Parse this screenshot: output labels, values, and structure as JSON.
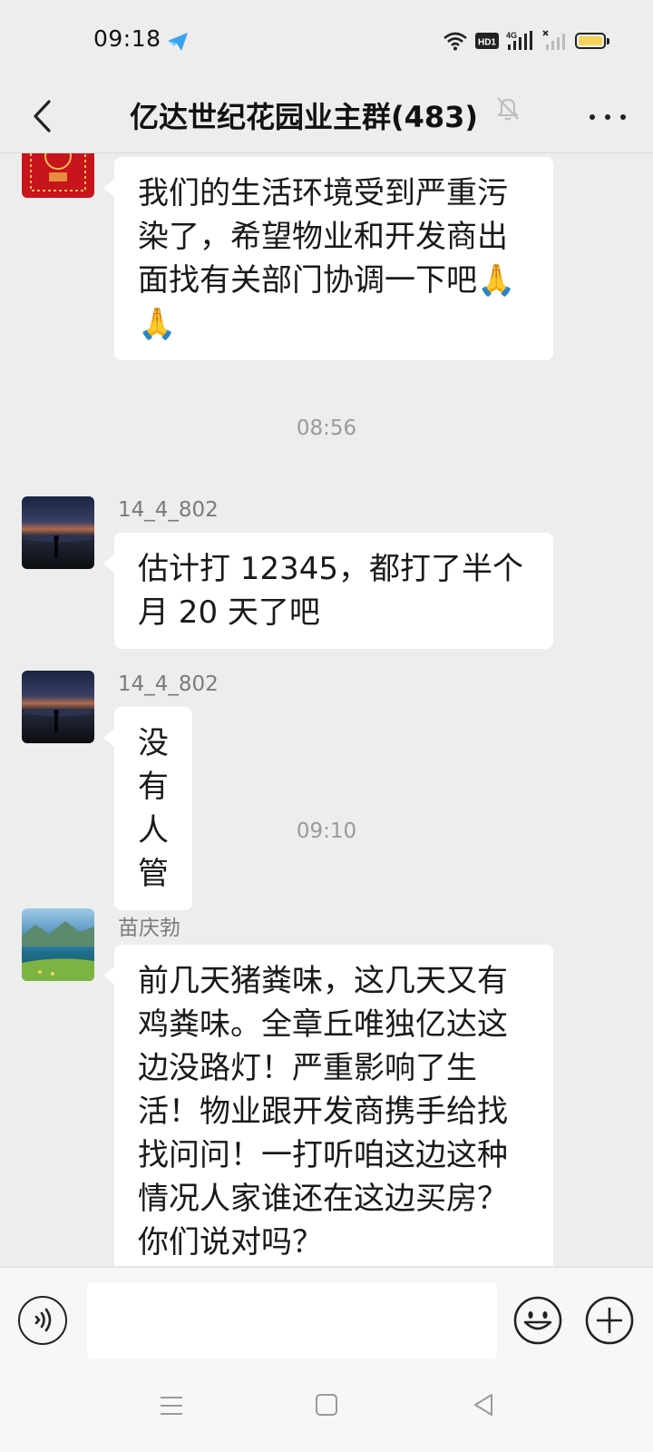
{
  "status_bar": {
    "time": "09:18",
    "app_icon": "feishu-icon",
    "hd_badge": "HD1",
    "net_badge": "4G",
    "battery_color": "#f5d35a"
  },
  "header": {
    "title": "亿达世纪花园业主群(483)",
    "back_icon": "back-arrow-icon",
    "mute_icon": "bell-muted-icon",
    "more_icon": "more-dots-icon"
  },
  "messages": [
    {
      "sender": "",
      "text_lines": [
        "我们的生活环境受到严重污",
        "染了，希望物业和开发商出",
        "面找有关部门协调一下吧🙏",
        "🙏"
      ]
    },
    {
      "timestamp": "08:56"
    },
    {
      "sender": "14_4_802",
      "text_lines": [
        "估计打 12345，都打了半个",
        "月 20 天了吧"
      ]
    },
    {
      "sender": "14_4_802",
      "text_lines": [
        "没有人管"
      ]
    },
    {
      "timestamp": "09:10"
    },
    {
      "sender": "苗庆勃",
      "text_lines": [
        "前几天猪粪味，这几天又有",
        "鸡粪味。全章丘唯独亿达这",
        "边没路灯！严重影响了生",
        "活！物业跟开发商携手给找",
        "找问问！一打听咱这边这种",
        "情况人家谁还在这边买房？",
        "你们说对吗？"
      ]
    }
  ],
  "input_bar": {
    "voice_icon": "voice-icon",
    "text_value": "",
    "emoji_icon": "emoji-icon",
    "plus_icon": "plus-icon"
  },
  "system_nav": {
    "menu_icon": "menu-icon",
    "home_icon": "home-icon",
    "back_icon": "back-triangle-icon"
  }
}
